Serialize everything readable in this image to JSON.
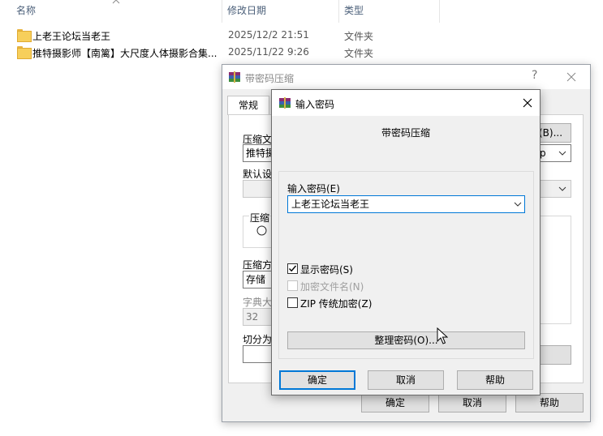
{
  "explorer": {
    "columns": {
      "name": "名称",
      "date": "修改日期",
      "type": "类型"
    },
    "files": [
      {
        "name": "上老王论坛当老王",
        "date": "2025/12/2 21:51",
        "type": "文件夹"
      },
      {
        "name": "推特摄影师【南篱】大尺度人体摄影合集...",
        "date": "2025/11/22 9:26",
        "type": "文件夹"
      }
    ]
  },
  "back_dialog": {
    "title": "带密码压缩",
    "help": "?",
    "tab_general": "常规",
    "browse_fragment": "(B)...",
    "format_fragment": "p",
    "label_archive": "压缩文",
    "archive_value": "推特摄",
    "label_default": "默认设",
    "label_compress": "压缩",
    "label_method": "压缩方",
    "method_value": "存储",
    "label_dict": "字典大",
    "dict_value": "32",
    "label_split": "切分为",
    "ok": "确定",
    "cancel": "取消",
    "help_btn": "帮助"
  },
  "front_dialog": {
    "title": "输入密码",
    "heading": "带密码压缩",
    "password_label": "输入密码(E)",
    "password_value": "上老王论坛当老王",
    "show_password": {
      "label": "显示密码(S)",
      "checked": true
    },
    "encrypt_names": {
      "label": "加密文件名(N)",
      "checked": false,
      "disabled": true
    },
    "zip_legacy": {
      "label": "ZIP 传统加密(Z)",
      "checked": false
    },
    "organize_button": "整理密码(O)...",
    "ok": "确定",
    "cancel": "取消",
    "help": "帮助"
  }
}
